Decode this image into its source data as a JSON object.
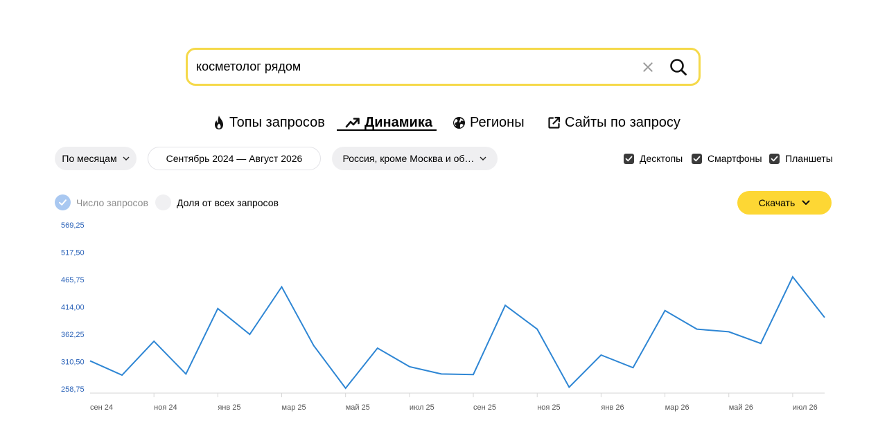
{
  "search": {
    "query": "косметолог рядом"
  },
  "tabs": [
    {
      "label": "Топы запросов",
      "icon": "fire-icon"
    },
    {
      "label": "Динамика",
      "icon": "trend-up-icon",
      "active": true
    },
    {
      "label": "Регионы",
      "icon": "globe-icon"
    },
    {
      "label": "Сайты по запросу",
      "icon": "external-link-icon"
    }
  ],
  "filters": {
    "period_granularity": "По месяцам",
    "date_range": "Сентябрь 2024 — Август 2026",
    "region": "Россия, кроме Москва и об…"
  },
  "devices": [
    {
      "label": "Десктопы",
      "checked": true
    },
    {
      "label": "Смартфоны",
      "checked": true
    },
    {
      "label": "Планшеты",
      "checked": true
    }
  ],
  "metrics": {
    "count_label": "Число запросов",
    "share_label": "Доля от всех запросов",
    "selected": "count"
  },
  "download": {
    "label": "Скачать"
  },
  "colors": {
    "accent_yellow": "#fdd734",
    "search_border": "#f5d94a",
    "line": "#2e86d4",
    "ytick": "#2a62b8"
  },
  "chart_data": {
    "type": "line",
    "x": [
      "сен 24",
      "окт 24",
      "ноя 24",
      "дек 24",
      "янв 25",
      "фев 25",
      "мар 25",
      "апр 25",
      "май 25",
      "июн 25",
      "июл 25",
      "авг 25",
      "сен 25",
      "окт 25",
      "ноя 25",
      "дек 25",
      "янв 26",
      "фев 26",
      "мар 26",
      "апр 26",
      "май 26",
      "июн 26",
      "июл 26",
      "авг 26"
    ],
    "x_tick_labels": [
      "сен 24",
      "ноя 24",
      "янв 25",
      "мар 25",
      "май 25",
      "июл 25",
      "сен 25",
      "ноя 25",
      "янв 26",
      "мар 26",
      "май 26",
      "июл 26"
    ],
    "y_tick_labels": [
      "569,25",
      "517,50",
      "465,75",
      "414,00",
      "362,25",
      "310,50",
      "258,75"
    ],
    "ylim": [
      258.75,
      569.25
    ],
    "series": [
      {
        "values": [
          312,
          285,
          349,
          287,
          411,
          362,
          452,
          341,
          260,
          336,
          301,
          287,
          286,
          417,
          372,
          262,
          323,
          299,
          407,
          372,
          367,
          345,
          471,
          394
        ]
      }
    ]
  }
}
